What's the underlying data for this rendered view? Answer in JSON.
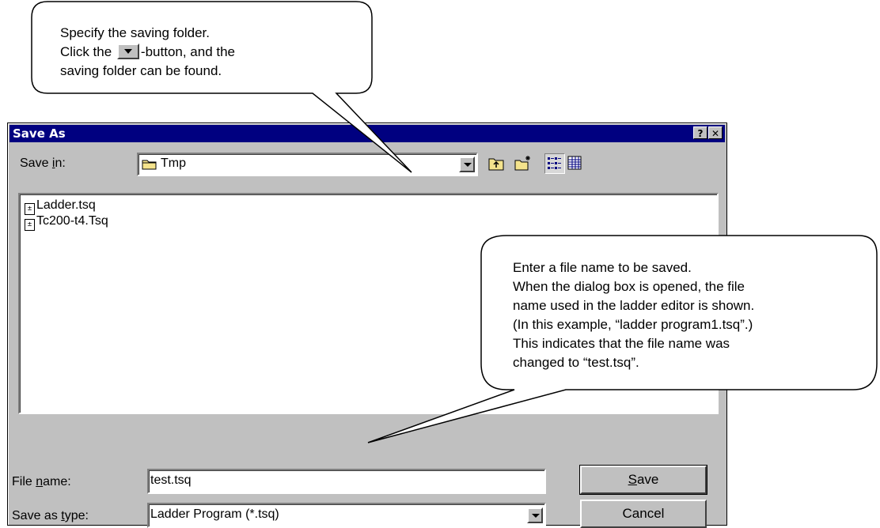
{
  "dialog": {
    "title": "Save As",
    "help_button": "?",
    "close_button": "✕",
    "save_in_label_prefix": "Save ",
    "save_in_label_mnemonic": "i",
    "save_in_label_suffix": "n:",
    "save_in_value": "Tmp",
    "files": [
      {
        "name": "Ladder.tsq"
      },
      {
        "name": "Tc200-t4.Tsq"
      }
    ],
    "file_name_label_prefix": "File ",
    "file_name_label_mnemonic": "n",
    "file_name_label_suffix": "ame:",
    "file_name_value": "test.tsq",
    "save_as_type_label_prefix": "Save as ",
    "save_as_type_label_mnemonic": "t",
    "save_as_type_label_suffix": "ype:",
    "save_as_type_value": "Ladder Program (*.tsq)",
    "save_button_mnemonic": "S",
    "save_button_rest": "ave",
    "cancel_button": "Cancel",
    "toolbar_icons": [
      "up-folder-icon",
      "new-folder-icon",
      "list-view-icon",
      "details-view-icon"
    ]
  },
  "callout_top": {
    "line1": "Specify the saving folder.",
    "line2_before": "Click the",
    "line2_after": "-button, and the",
    "line3": "saving folder can be found."
  },
  "callout_right": {
    "lines": [
      "Enter a file name to be saved.",
      "When the dialog box is opened, the file",
      "name used in the ladder editor is shown.",
      "(In this example, “ladder program1.tsq”.)",
      "This indicates that the file name was",
      "changed to “test.tsq”."
    ]
  },
  "colors": {
    "title_bar": "#000080",
    "dialog_face": "#c0c0c0"
  }
}
